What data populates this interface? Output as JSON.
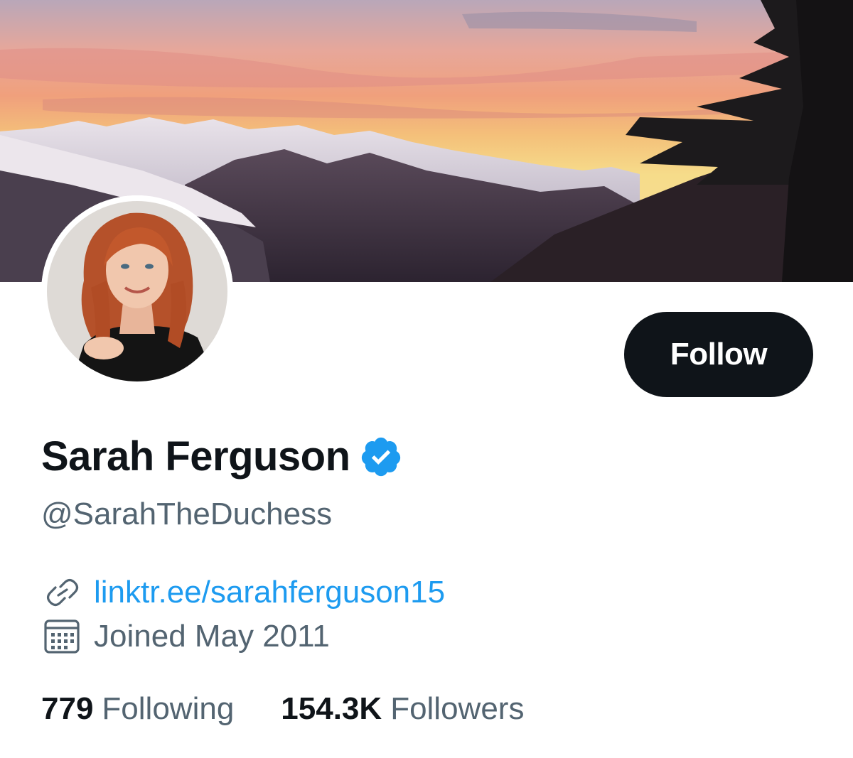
{
  "profile": {
    "display_name": "Sarah Ferguson",
    "handle": "@SarahTheDuchess",
    "verified": true,
    "website": "linktr.ee/sarahferguson15",
    "joined": "Joined May 2011"
  },
  "actions": {
    "follow_label": "Follow"
  },
  "stats": {
    "following_count": "779",
    "following_label": "Following",
    "followers_count": "154.3K",
    "followers_label": "Followers"
  },
  "icons": {
    "verified": "verified-badge-icon",
    "link": "link-icon",
    "calendar": "calendar-icon"
  },
  "colors": {
    "accent": "#1d9bf0",
    "text_primary": "#0f1419",
    "text_secondary": "#536471",
    "follow_button_bg": "#0f1419"
  }
}
